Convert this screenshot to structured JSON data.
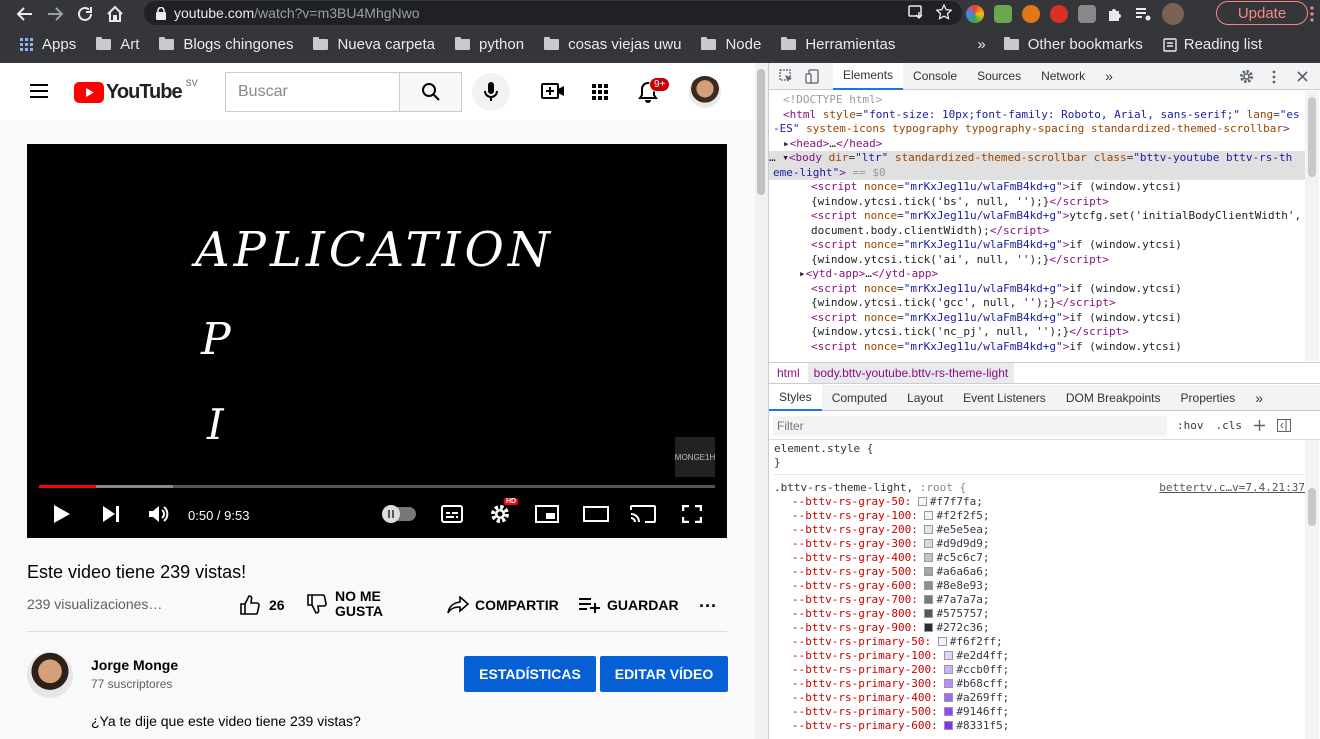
{
  "browser": {
    "url_host": "youtube.com",
    "url_path": "/watch?v=m3BU4MhgNwo",
    "update_label": "Update",
    "bookmarks": [
      "Apps",
      "Art",
      "Blogs chingones",
      "Nueva carpeta",
      "python",
      "cosas viejas uwu",
      "Node",
      "Herramientas"
    ],
    "more_label": "»",
    "other_bookmarks": "Other bookmarks",
    "reading_list": "Reading list"
  },
  "youtube": {
    "logo_text": "YouTube",
    "logo_region": "SV",
    "search_placeholder": "Buscar",
    "notification_count": "9+",
    "video_overlay": {
      "line1": "APLICATION",
      "line2": "P",
      "line3": "I",
      "watermark": "MONGE1H"
    },
    "player": {
      "time": "0:50 / 9:53",
      "played_fraction": 0.084,
      "hd_badge": "HD"
    },
    "title": "Este video tiene 239 vistas!",
    "views": "239 visualizaciones…",
    "likes": "26",
    "dislike_label_1": "NO ME",
    "dislike_label_2": "GUSTA",
    "share_label": "COMPARTIR",
    "save_label": "GUARDAR",
    "more_label": "···",
    "channel_name": "Jorge Monge",
    "subscribers": "77 suscriptores",
    "stats_button": "ESTADÍSTICAS",
    "edit_button": "EDITAR VÍDEO",
    "description": "¿Ya te dije que este video tiene 239 vistas?"
  },
  "devtools": {
    "tabs": [
      "Elements",
      "Console",
      "Sources",
      "Network"
    ],
    "tabs_more": "»",
    "breadcrumb": [
      "html",
      "body.bttv-youtube.bttv-rs-theme-light"
    ],
    "sub_tabs": [
      "Styles",
      "Computed",
      "Layout",
      "Event Listeners",
      "DOM Breakpoints",
      "Properties"
    ],
    "sub_tabs_more": "»",
    "filter_placeholder": "Filter",
    "hov": ":hov",
    "cls": ".cls",
    "element_style_open": "element.style {",
    "element_style_close": "}",
    "rule_selector": ".bttv-rs-theme-light,",
    "rule_selector_2": ":root {",
    "rule_source": "bettertv.c…v=7.4.21:37",
    "variables": [
      {
        "name": "--bttv-rs-gray-50:",
        "value": "#f7f7fa;",
        "color": "#f7f7fa"
      },
      {
        "name": "--bttv-rs-gray-100:",
        "value": "#f2f2f5;",
        "color": "#f2f2f5"
      },
      {
        "name": "--bttv-rs-gray-200:",
        "value": "#e5e5ea;",
        "color": "#e5e5ea"
      },
      {
        "name": "--bttv-rs-gray-300:",
        "value": "#d9d9d9;",
        "color": "#d9d9d9"
      },
      {
        "name": "--bttv-rs-gray-400:",
        "value": "#c5c6c7;",
        "color": "#c5c6c7"
      },
      {
        "name": "--bttv-rs-gray-500:",
        "value": "#a6a6a6;",
        "color": "#a6a6a6"
      },
      {
        "name": "--bttv-rs-gray-600:",
        "value": "#8e8e93;",
        "color": "#8e8e93"
      },
      {
        "name": "--bttv-rs-gray-700:",
        "value": "#7a7a7a;",
        "color": "#7a7a7a"
      },
      {
        "name": "--bttv-rs-gray-800:",
        "value": "#575757;",
        "color": "#575757"
      },
      {
        "name": "--bttv-rs-gray-900:",
        "value": "#272c36;",
        "color": "#272c36"
      },
      {
        "name": "--bttv-rs-primary-50:",
        "value": "#f6f2ff;",
        "color": "#f6f2ff"
      },
      {
        "name": "--bttv-rs-primary-100:",
        "value": "#e2d4ff;",
        "color": "#e2d4ff"
      },
      {
        "name": "--bttv-rs-primary-200:",
        "value": "#ccb0ff;",
        "color": "#ccb0ff"
      },
      {
        "name": "--bttv-rs-primary-300:",
        "value": "#b68cff;",
        "color": "#b68cff"
      },
      {
        "name": "--bttv-rs-primary-400:",
        "value": "#a269ff;",
        "color": "#a269ff"
      },
      {
        "name": "--bttv-rs-primary-500:",
        "value": "#9146ff;",
        "color": "#9146ff"
      },
      {
        "name": "--bttv-rs-primary-600:",
        "value": "#8331f5;",
        "color": "#8331f5"
      }
    ]
  },
  "colors": {
    "yt_red": "#ff0000",
    "yt_blue": "#065fd4",
    "dt_accent": "#1a73e8",
    "update": "#f28b82"
  }
}
